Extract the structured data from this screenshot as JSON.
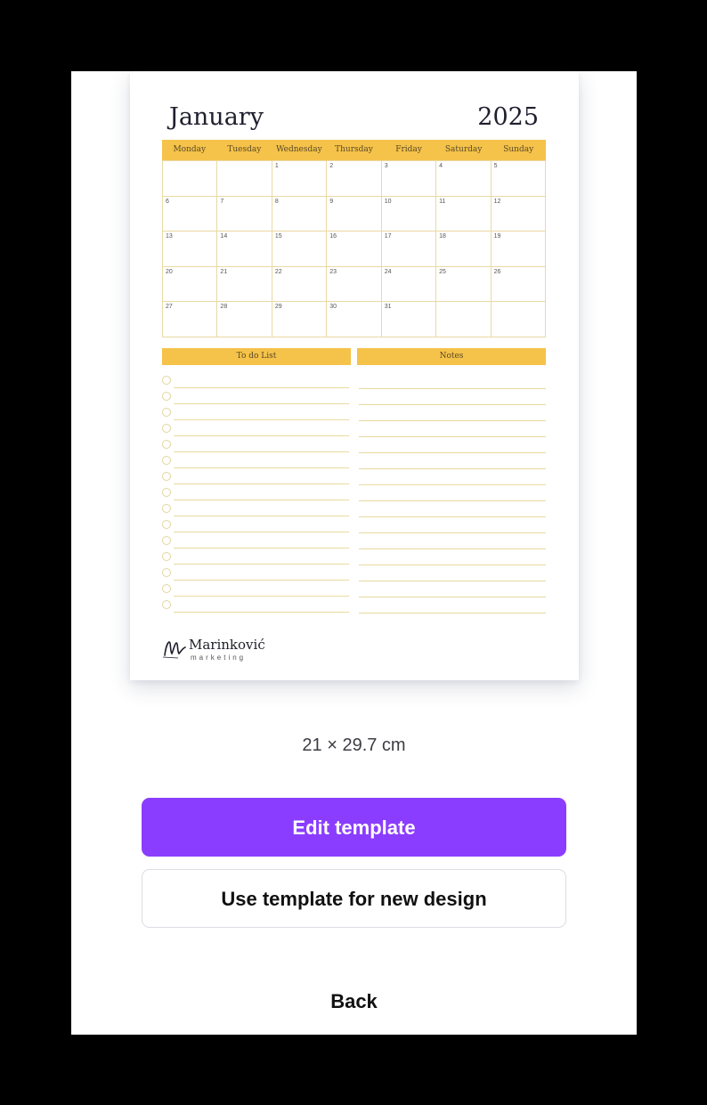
{
  "template_preview": {
    "month": "January",
    "year": "2025",
    "weekdays": [
      "Monday",
      "Tuesday",
      "Wednesday",
      "Thursday",
      "Friday",
      "Saturday",
      "Sunday"
    ],
    "days": [
      "",
      "",
      "1",
      "2",
      "3",
      "4",
      "5",
      "6",
      "7",
      "8",
      "9",
      "10",
      "11",
      "12",
      "13",
      "14",
      "15",
      "16",
      "17",
      "18",
      "19",
      "20",
      "21",
      "22",
      "23",
      "24",
      "25",
      "26",
      "27",
      "28",
      "29",
      "30",
      "31",
      "",
      ""
    ],
    "todo_label": "To do List",
    "notes_label": "Notes",
    "todo_rows": 15,
    "notes_rows": 15,
    "logo": {
      "name": "Marinković",
      "sub": "marketing"
    },
    "accent_color": "#f5c24a"
  },
  "size_label": "21 × 29.7 cm",
  "buttons": {
    "edit": "Edit template",
    "use": "Use template for new design",
    "back": "Back"
  },
  "colors": {
    "primary": "#8b3dff"
  }
}
